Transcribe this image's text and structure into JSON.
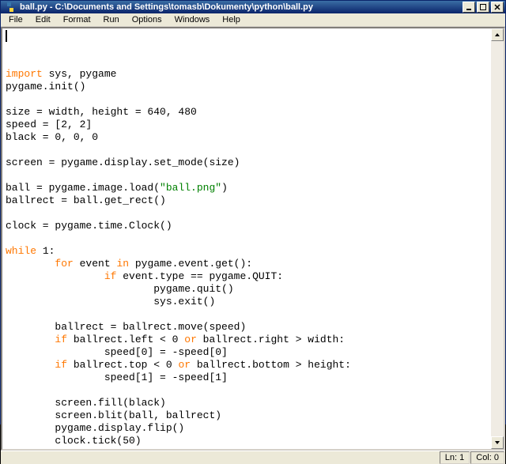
{
  "window": {
    "title": "ball.py - C:\\Documents and Settings\\tomasb\\Dokumenty\\python\\ball.py"
  },
  "menu": {
    "items": [
      "File",
      "Edit",
      "Format",
      "Run",
      "Options",
      "Windows",
      "Help"
    ]
  },
  "code": {
    "lines": [
      [
        [
          "kw-orange",
          "import"
        ],
        [
          "",
          " sys, pygame"
        ]
      ],
      [
        [
          "",
          "pygame.init()"
        ]
      ],
      [
        [
          "",
          ""
        ]
      ],
      [
        [
          "",
          "size = width, height = 640, 480"
        ]
      ],
      [
        [
          "",
          "speed = [2, 2]"
        ]
      ],
      [
        [
          "",
          "black = 0, 0, 0"
        ]
      ],
      [
        [
          "",
          ""
        ]
      ],
      [
        [
          "",
          "screen = pygame.display.set_mode(size)"
        ]
      ],
      [
        [
          "",
          ""
        ]
      ],
      [
        [
          "",
          "ball = pygame.image.load("
        ],
        [
          "kw-green",
          "\"ball.png\""
        ],
        [
          "",
          ")"
        ]
      ],
      [
        [
          "",
          "ballrect = ball.get_rect()"
        ]
      ],
      [
        [
          "",
          ""
        ]
      ],
      [
        [
          "",
          "clock = pygame.time.Clock()"
        ]
      ],
      [
        [
          "",
          ""
        ]
      ],
      [
        [
          "kw-orange",
          "while"
        ],
        [
          "",
          " 1:"
        ]
      ],
      [
        [
          "",
          "        "
        ],
        [
          "kw-orange",
          "for"
        ],
        [
          "",
          " event "
        ],
        [
          "kw-orange",
          "in"
        ],
        [
          "",
          " pygame.event.get():"
        ]
      ],
      [
        [
          "",
          "                "
        ],
        [
          "kw-orange",
          "if"
        ],
        [
          "",
          " event.type == pygame.QUIT:"
        ]
      ],
      [
        [
          "",
          "                        pygame.quit()"
        ]
      ],
      [
        [
          "",
          "                        sys.exit()"
        ]
      ],
      [
        [
          "",
          ""
        ]
      ],
      [
        [
          "",
          "        ballrect = ballrect.move(speed)"
        ]
      ],
      [
        [
          "",
          "        "
        ],
        [
          "kw-orange",
          "if"
        ],
        [
          "",
          " ballrect.left < 0 "
        ],
        [
          "kw-orange",
          "or"
        ],
        [
          "",
          " ballrect.right > width:"
        ]
      ],
      [
        [
          "",
          "                speed[0] = -speed[0]"
        ]
      ],
      [
        [
          "",
          "        "
        ],
        [
          "kw-orange",
          "if"
        ],
        [
          "",
          " ballrect.top < 0 "
        ],
        [
          "kw-orange",
          "or"
        ],
        [
          "",
          " ballrect.bottom > height:"
        ]
      ],
      [
        [
          "",
          "                speed[1] = -speed[1]"
        ]
      ],
      [
        [
          "",
          ""
        ]
      ],
      [
        [
          "",
          "        screen.fill(black)"
        ]
      ],
      [
        [
          "",
          "        screen.blit(ball, ballrect)"
        ]
      ],
      [
        [
          "",
          "        pygame.display.flip()"
        ]
      ],
      [
        [
          "",
          "        clock.tick(50)"
        ]
      ]
    ]
  },
  "status": {
    "line": "Ln: 1",
    "col": "Col: 0"
  }
}
